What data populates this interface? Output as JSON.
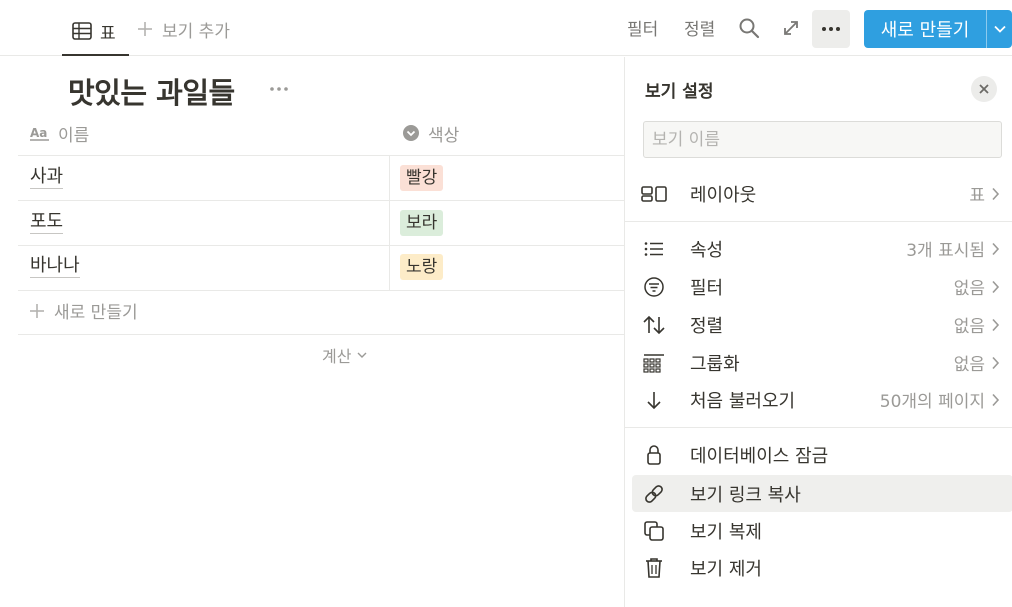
{
  "tabs": {
    "active_view_label": "표",
    "add_view_label": "보기 추가"
  },
  "toolbar": {
    "filter_label": "필터",
    "sort_label": "정렬",
    "new_button_label": "새로 만들기"
  },
  "database": {
    "title": "맛있는 과일들",
    "columns": [
      {
        "name": "이름",
        "type_icon": "text-type-icon"
      },
      {
        "name": "색상",
        "type_icon": "select-type-icon"
      }
    ],
    "rows": [
      {
        "name": "사과",
        "color": {
          "label": "빨강",
          "bg": "#fbe0d6"
        }
      },
      {
        "name": "포도",
        "color": {
          "label": "보라",
          "bg": "#dbeddb"
        }
      },
      {
        "name": "바나나",
        "color": {
          "label": "노랑",
          "bg": "#fdecc8"
        }
      }
    ],
    "new_row_label": "새로 만들기",
    "calculate_label": "계산"
  },
  "panel": {
    "title": "보기 설정",
    "view_name_placeholder": "보기 이름",
    "layout": {
      "label": "레이아웃",
      "value": "표"
    },
    "settings": [
      {
        "icon": "list-icon",
        "label": "속성",
        "value": "3개 표시됨"
      },
      {
        "icon": "filter-icon",
        "label": "필터",
        "value": "없음"
      },
      {
        "icon": "sort-icon",
        "label": "정렬",
        "value": "없음"
      },
      {
        "icon": "group-icon",
        "label": "그룹화",
        "value": "없음"
      },
      {
        "icon": "arrow-down-icon",
        "label": "처음 불러오기",
        "value": "50개의 페이지"
      }
    ],
    "actions": [
      {
        "icon": "lock-icon",
        "label": "데이터베이스 잠금"
      },
      {
        "icon": "link-icon",
        "label": "보기 링크 복사"
      },
      {
        "icon": "duplicate-icon",
        "label": "보기 복제"
      },
      {
        "icon": "trash-icon",
        "label": "보기 제거"
      }
    ]
  },
  "colors": {
    "accent": "#2f9fe0",
    "text": "#37352f",
    "muted": "#9b9a97",
    "tag_red": "#fbe0d6",
    "tag_purple": "#dbeddb",
    "tag_yellow": "#fdecc8",
    "hover_row": "#efefed"
  }
}
